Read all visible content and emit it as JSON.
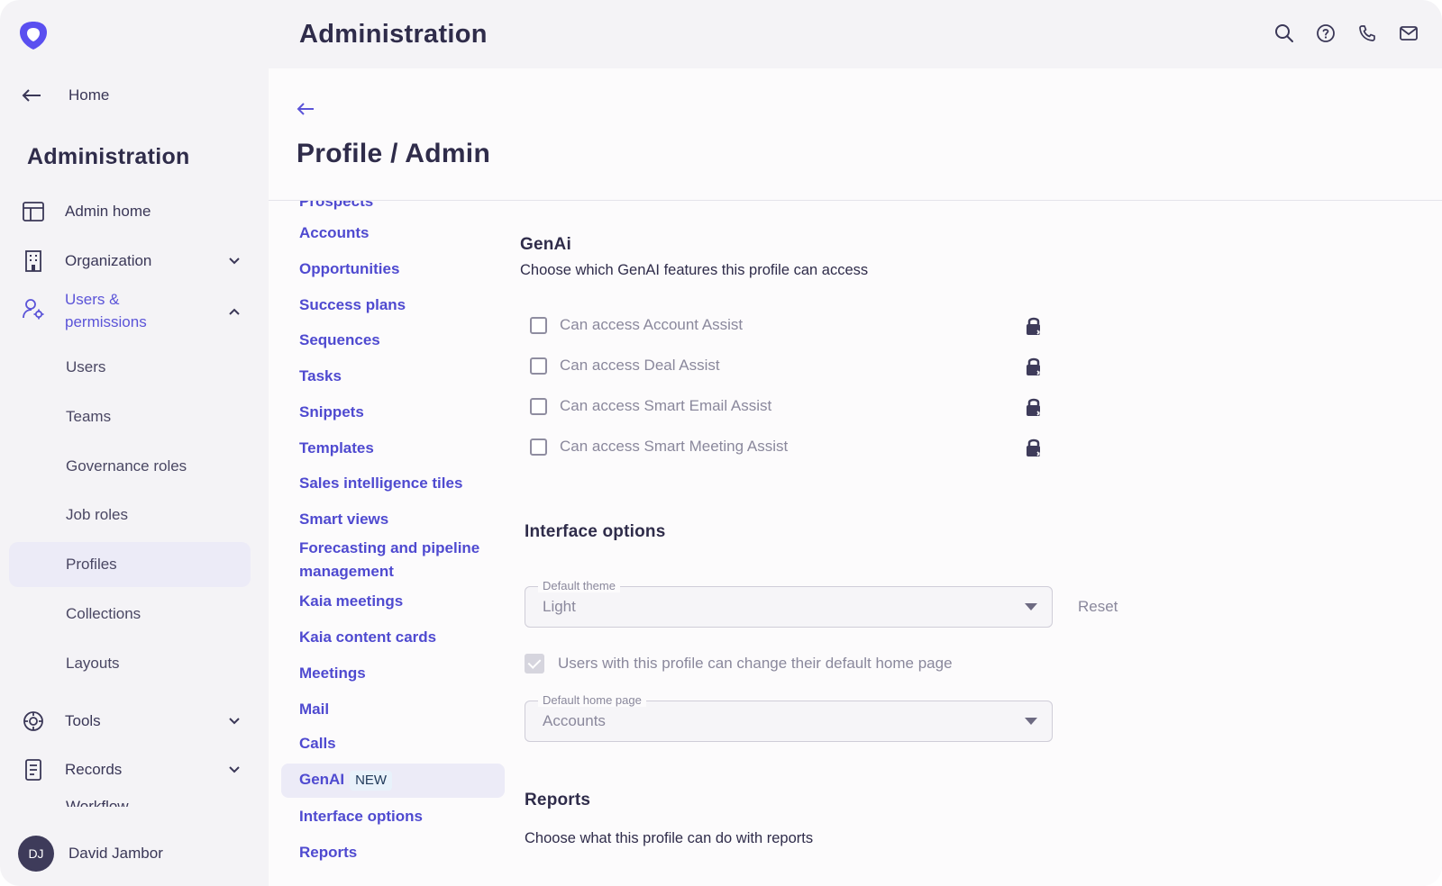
{
  "header": {
    "title": "Administration"
  },
  "sidebar": {
    "home_label": "Home",
    "title": "Administration",
    "items": [
      {
        "label": "Admin home",
        "icon": "layout-icon"
      },
      {
        "label": "Organization",
        "icon": "building-icon",
        "expanded": false
      },
      {
        "label": "Users & permissions",
        "icon": "user-gear-icon",
        "expanded": true
      },
      {
        "label": "Tools",
        "icon": "tools-icon",
        "expanded": false
      },
      {
        "label": "Records",
        "icon": "records-icon",
        "expanded": false
      }
    ],
    "users_label_1": "Users &",
    "users_label_2": "permissions",
    "sub_items": [
      "Users",
      "Teams",
      "Governance roles",
      "Job roles",
      "Profiles",
      "Collections",
      "Layouts"
    ],
    "selected_sub_item": "Profiles",
    "cutoff_item": "Workflow",
    "user": {
      "initials": "DJ",
      "name": "David Jambor"
    }
  },
  "page": {
    "title": "Profile /  Admin"
  },
  "subnav": {
    "cutoff_top": "Prospects",
    "items": [
      "Accounts",
      "Opportunities",
      "Success plans",
      "Sequences",
      "Tasks",
      "Snippets",
      "Templates",
      "Sales intelligence tiles",
      "Smart views"
    ],
    "forecasting_1": "Forecasting and pipeline",
    "forecasting_2": "management",
    "items_after": [
      "Kaia meetings",
      "Kaia content cards",
      "Meetings",
      "Mail",
      "Calls"
    ],
    "genai": {
      "label": "GenAI",
      "badge": "NEW"
    },
    "items_end": [
      "Interface options",
      "Reports"
    ]
  },
  "genai_section": {
    "title": "GenAi",
    "description": "Choose which GenAI features this profile can access",
    "options": [
      {
        "label": "Can access Account Assist",
        "checked": false,
        "locked": true
      },
      {
        "label": "Can access Deal Assist",
        "checked": false,
        "locked": true
      },
      {
        "label": "Can access Smart Email Assist",
        "checked": false,
        "locked": true
      },
      {
        "label": "Can access Smart Meeting Assist",
        "checked": false,
        "locked": true
      }
    ]
  },
  "interface_section": {
    "title": "Interface options",
    "theme_label": "Default theme",
    "theme_value": "Light",
    "reset_label": "Reset",
    "home_change_label": "Users with this profile can change their default home page",
    "home_change_checked": true,
    "home_page_label": "Default home page",
    "home_page_value": "Accounts"
  },
  "reports_section": {
    "title": "Reports",
    "description": "Choose what this profile can do with reports"
  },
  "colors": {
    "accent": "#5b54d8",
    "link": "#4f4ad0",
    "logo": "#5a4ff0"
  }
}
